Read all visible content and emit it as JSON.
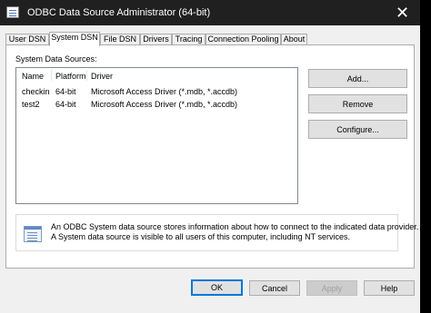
{
  "window": {
    "title": "ODBC Data Source Administrator (64-bit)",
    "close_glyph": "✕"
  },
  "tabs": [
    {
      "label": "User DSN"
    },
    {
      "label": "System DSN",
      "active": true
    },
    {
      "label": "File DSN"
    },
    {
      "label": "Drivers"
    },
    {
      "label": "Tracing"
    },
    {
      "label": "Connection Pooling"
    },
    {
      "label": "About"
    }
  ],
  "panel": {
    "label": "System Data Sources:",
    "columns": [
      "Name",
      "Platform",
      "Driver"
    ],
    "rows": [
      {
        "name": "checkin",
        "platform": "64-bit",
        "driver": "Microsoft Access Driver (*.mdb, *.accdb)"
      },
      {
        "name": "test2",
        "platform": "64-bit",
        "driver": "Microsoft Access Driver (*.mdb, *.accdb)"
      }
    ],
    "buttons": {
      "add": "Add...",
      "remove": "Remove",
      "configure": "Configure..."
    },
    "info": {
      "line1": "An ODBC System data source stores information about how to connect to the indicated data provider.",
      "line2": "A System data source is visible to all users of this computer, including NT services."
    }
  },
  "footer": {
    "ok": "OK",
    "cancel": "Cancel",
    "apply": "Apply",
    "help": "Help"
  },
  "colors": {
    "titlebar": "#202020",
    "accent": "#0078d7",
    "dialog_bg": "#f0f0f0"
  },
  "icons": {
    "title": "odbc-window-icon",
    "info": "data-source-info-icon"
  }
}
